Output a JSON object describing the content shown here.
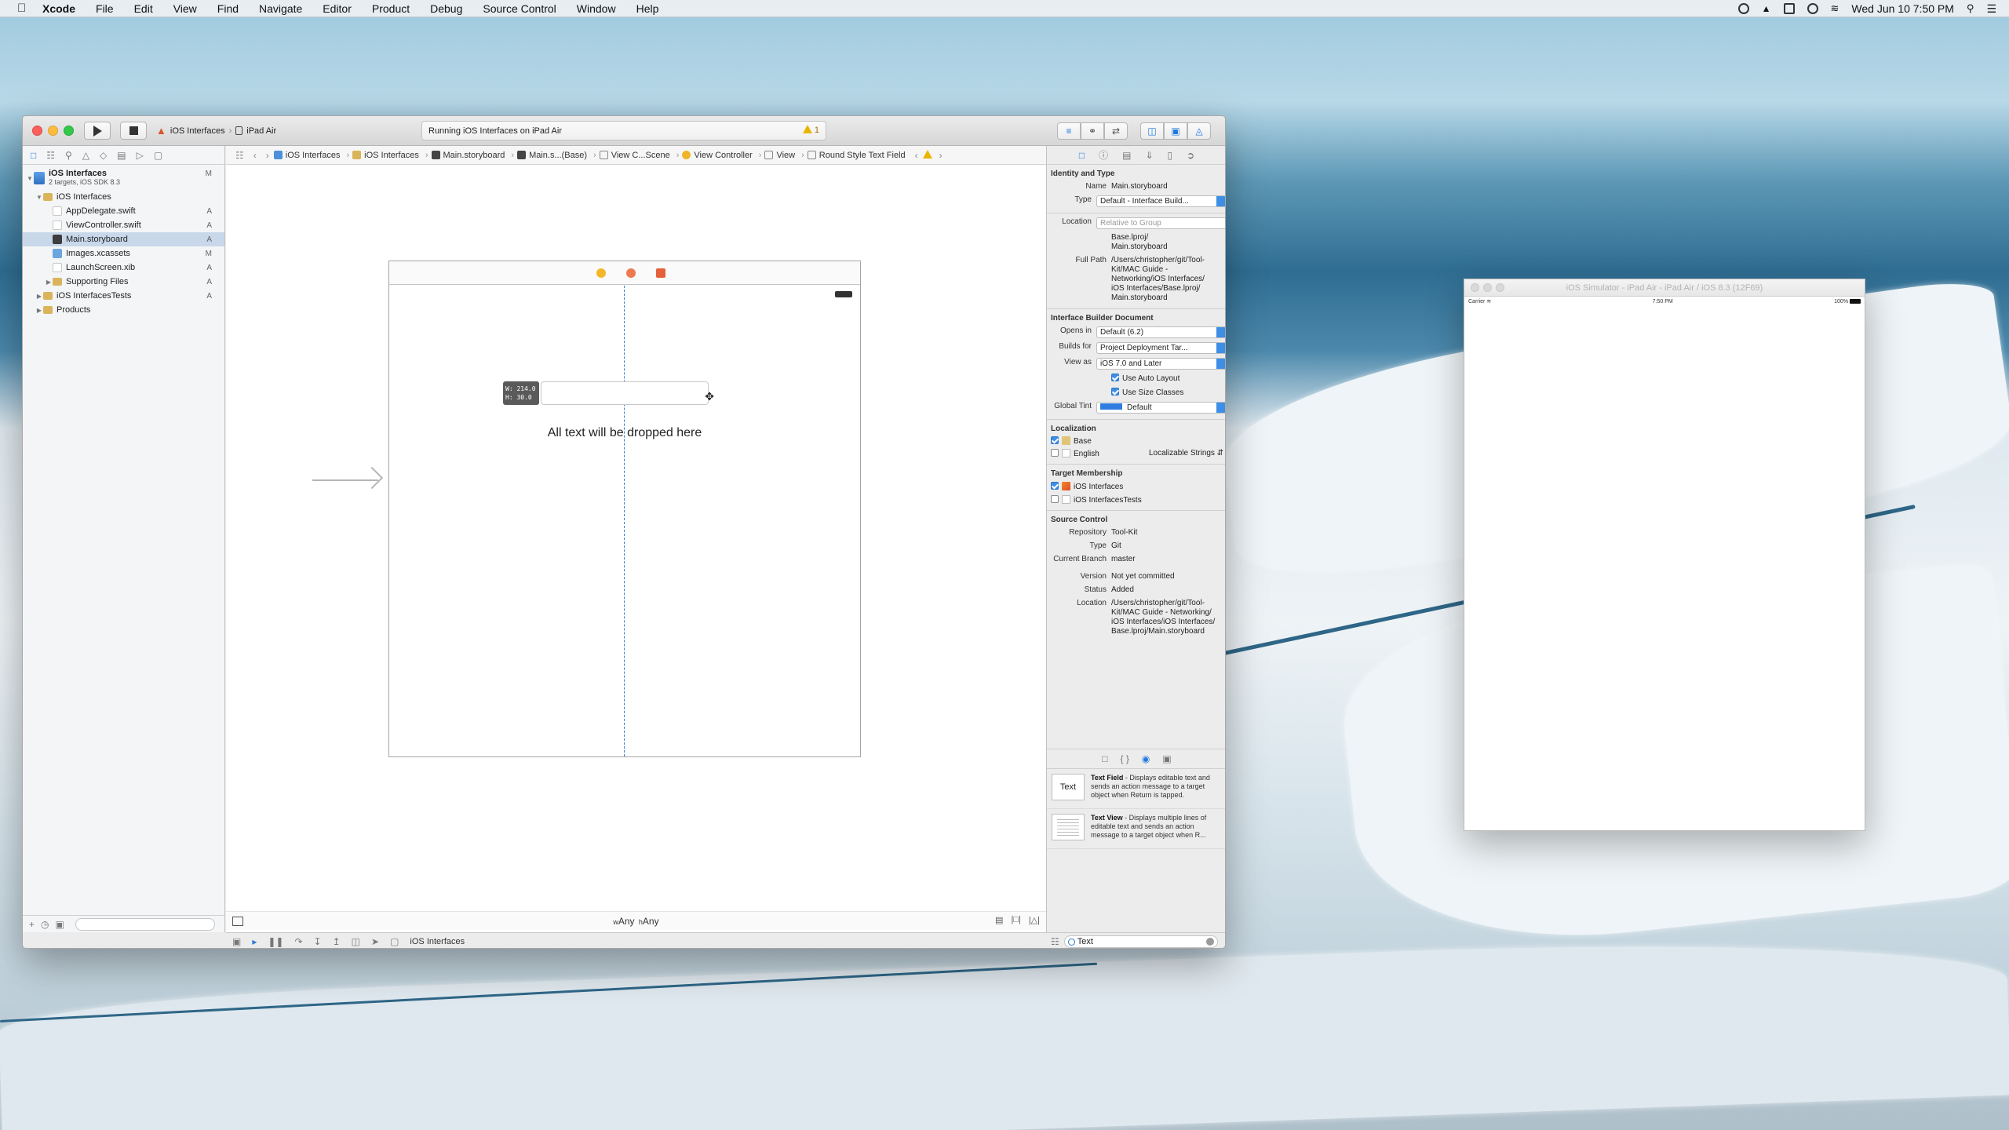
{
  "menubar": {
    "app": "Xcode",
    "items": [
      "File",
      "Edit",
      "View",
      "Find",
      "Navigate",
      "Editor",
      "Product",
      "Debug",
      "Source Control",
      "Window",
      "Help"
    ],
    "clock": "Wed Jun 10  7:50 PM"
  },
  "toolbar": {
    "scheme": "iOS Interfaces",
    "device": "iPad Air",
    "status": "Running iOS Interfaces on iPad Air",
    "warning_count": "1"
  },
  "navigator": {
    "project": "iOS Interfaces",
    "project_sub": "2 targets, iOS SDK 8.3",
    "project_badge": "M",
    "items": [
      {
        "label": "iOS Interfaces",
        "badge": ""
      },
      {
        "label": "AppDelegate.swift",
        "badge": "A"
      },
      {
        "label": "ViewController.swift",
        "badge": "A"
      },
      {
        "label": "Main.storyboard",
        "badge": "A"
      },
      {
        "label": "Images.xcassets",
        "badge": "M"
      },
      {
        "label": "LaunchScreen.xib",
        "badge": "A"
      },
      {
        "label": "Supporting Files",
        "badge": "A"
      },
      {
        "label": "iOS InterfacesTests",
        "badge": "A"
      },
      {
        "label": "Products",
        "badge": ""
      }
    ]
  },
  "jumpbar": {
    "crumbs": [
      "iOS Interfaces",
      "iOS Interfaces",
      "Main.storyboard",
      "Main.s...(Base)",
      "View C...Scene",
      "View Controller",
      "View",
      "Round Style Text Field"
    ]
  },
  "canvas": {
    "size_w": "W: 214.0",
    "size_h": "H:  30.0",
    "drop_label": "All text will be dropped here",
    "size_class_w": "Any",
    "size_class_h": "Any"
  },
  "debugbar": {
    "target": "iOS Interfaces"
  },
  "inspector": {
    "identity_title": "Identity and Type",
    "name_label": "Name",
    "name_value": "Main.storyboard",
    "type_label": "Type",
    "type_value": "Default - Interface Build...",
    "location_label": "Location",
    "location_value": "Relative to Group",
    "location_path1": "Base.lproj/",
    "location_path2": "Main.storyboard",
    "fullpath_label": "Full Path",
    "fullpath_lines": [
      "/Users/christopher/git/Tool-",
      "Kit/MAC Guide -",
      "Networking/iOS Interfaces/",
      "iOS Interfaces/Base.lproj/",
      "Main.storyboard"
    ],
    "ib_title": "Interface Builder Document",
    "opens_label": "Opens in",
    "opens_value": "Default (6.2)",
    "builds_label": "Builds for",
    "builds_value": "Project Deployment Tar...",
    "viewas_label": "View as",
    "viewas_value": "iOS 7.0 and Later",
    "auto_layout": "Use Auto Layout",
    "size_classes": "Use Size Classes",
    "tint_label": "Global Tint",
    "tint_value": "Default",
    "loc_title": "Localization",
    "loc_base": "Base",
    "loc_english": "English",
    "loc_strings": "Localizable Strings",
    "target_title": "Target Membership",
    "target1": "iOS Interfaces",
    "target2": "iOS InterfacesTests",
    "sc_title": "Source Control",
    "repo_label": "Repository",
    "repo_value": "Tool-Kit",
    "sctype_label": "Type",
    "sctype_value": "Git",
    "branch_label": "Current Branch",
    "branch_value": "master",
    "version_label": "Version",
    "version_value": "Not yet committed",
    "status_label": "Status",
    "status_value": "Added",
    "sclocation_label": "Location",
    "sclocation_lines": [
      "/Users/christopher/git/Tool-",
      "Kit/MAC Guide - Networking/",
      "iOS Interfaces/iOS Interfaces/",
      "Base.lproj/Main.storyboard"
    ]
  },
  "library": {
    "item1_thumb": "Text",
    "item1_name": "Text Field",
    "item1_desc": " - Displays editable text and sends an action message to a target object when Return is tapped.",
    "item2_name": "Text View",
    "item2_desc": " - Displays multiple lines of editable text and sends an action message to a target object when R...",
    "search": "Text"
  },
  "simulator": {
    "title": "iOS Simulator - iPad Air - iPad Air / iOS 8.3 (12F69)",
    "carrier": "Carrier",
    "time": "7:50 PM",
    "battery": "100%"
  }
}
